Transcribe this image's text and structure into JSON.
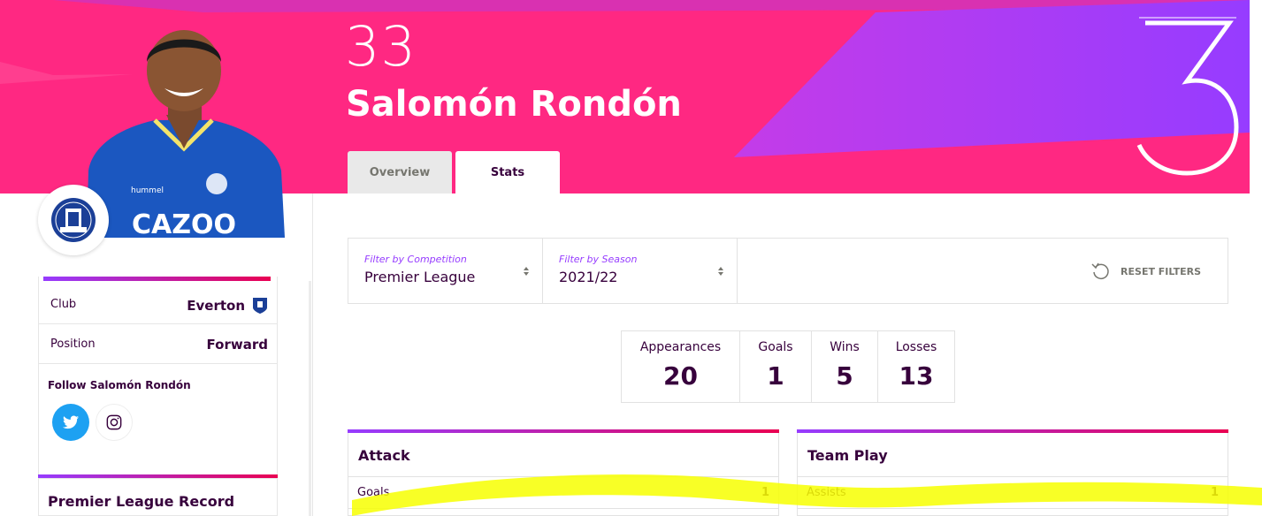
{
  "player": {
    "shirt_number": "33",
    "name": "Salomón Rondón",
    "big_number": "3"
  },
  "tabs": [
    {
      "label": "Overview",
      "active": false
    },
    {
      "label": "Stats",
      "active": true
    }
  ],
  "filters": {
    "competition_label": "Filter by Competition",
    "competition_value": "Premier League",
    "season_label": "Filter by Season",
    "season_value": "2021/22",
    "reset_label": "RESET FILTERS"
  },
  "summary": [
    {
      "label": "Appearances",
      "value": "20"
    },
    {
      "label": "Goals",
      "value": "1"
    },
    {
      "label": "Wins",
      "value": "5"
    },
    {
      "label": "Losses",
      "value": "13"
    }
  ],
  "cards": [
    {
      "title": "Attack",
      "rows": [
        {
          "label": "Goals",
          "value": "1"
        }
      ]
    },
    {
      "title": "Team Play",
      "rows": [
        {
          "label": "Assists",
          "value": "1"
        }
      ]
    }
  ],
  "sidebar": {
    "club_label": "Club",
    "club_value": "Everton",
    "position_label": "Position",
    "position_value": "Forward",
    "follow_label": "Follow Salomón Rondón",
    "record_title": "Premier League Record",
    "social_icons": [
      "twitter-icon",
      "instagram-icon"
    ],
    "shirt_sponsor": "CAZOO",
    "kit_brand": "hummel"
  },
  "colors": {
    "hero_pink": "#ff2882",
    "hero_purple": "#963cff",
    "primary_text": "#37003c",
    "filter_label": "#963cff",
    "everton_blue": "#1b3f97",
    "twitter_blue": "#1da1f2",
    "highlighter_yellow": "#f7ff00"
  }
}
